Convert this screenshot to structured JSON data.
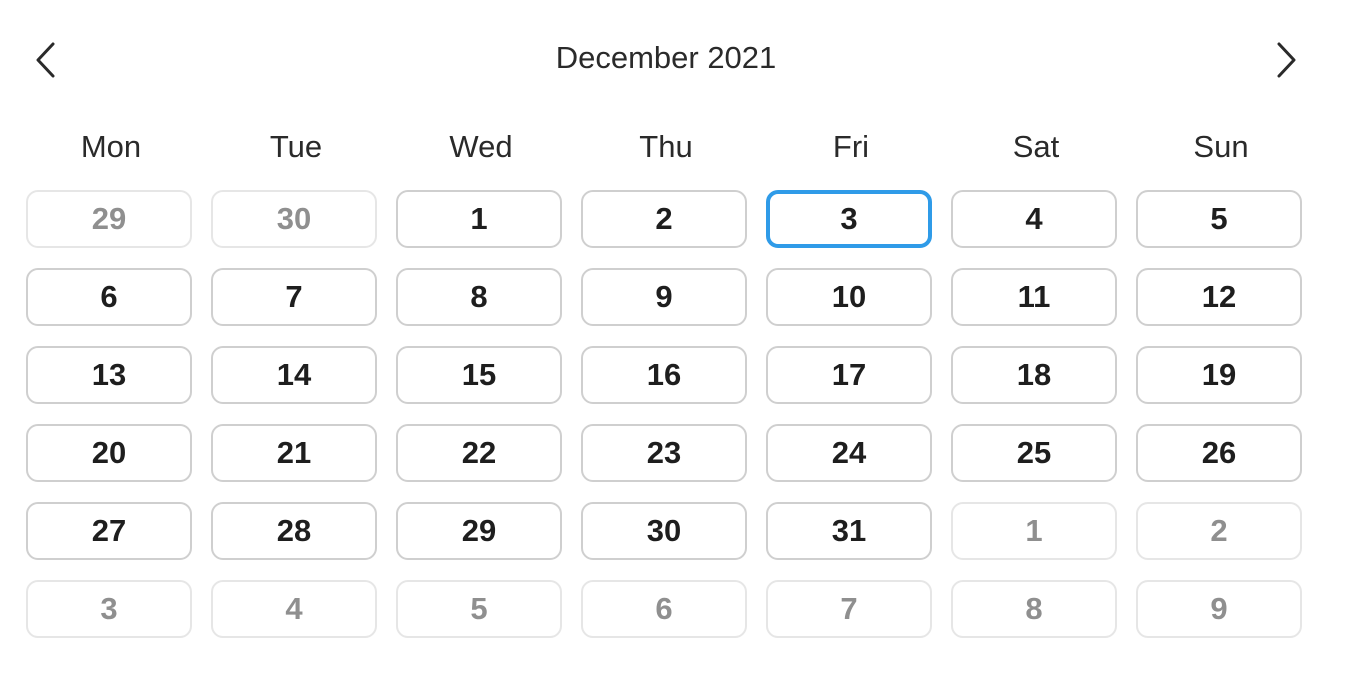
{
  "calendar": {
    "title": "December 2021",
    "prev_icon": "chevron-left-icon",
    "next_icon": "chevron-right-icon",
    "accent_color": "#2f9be8",
    "weekdays": [
      "Mon",
      "Tue",
      "Wed",
      "Thu",
      "Fri",
      "Sat",
      "Sun"
    ],
    "weeks": [
      [
        {
          "label": "29",
          "outside": true
        },
        {
          "label": "30",
          "outside": true
        },
        {
          "label": "1"
        },
        {
          "label": "2"
        },
        {
          "label": "3",
          "selected": true
        },
        {
          "label": "4"
        },
        {
          "label": "5"
        }
      ],
      [
        {
          "label": "6"
        },
        {
          "label": "7"
        },
        {
          "label": "8"
        },
        {
          "label": "9"
        },
        {
          "label": "10"
        },
        {
          "label": "11"
        },
        {
          "label": "12"
        }
      ],
      [
        {
          "label": "13"
        },
        {
          "label": "14"
        },
        {
          "label": "15"
        },
        {
          "label": "16"
        },
        {
          "label": "17"
        },
        {
          "label": "18"
        },
        {
          "label": "19"
        }
      ],
      [
        {
          "label": "20"
        },
        {
          "label": "21"
        },
        {
          "label": "22"
        },
        {
          "label": "23"
        },
        {
          "label": "24"
        },
        {
          "label": "25"
        },
        {
          "label": "26"
        }
      ],
      [
        {
          "label": "27"
        },
        {
          "label": "28"
        },
        {
          "label": "29"
        },
        {
          "label": "30"
        },
        {
          "label": "31"
        },
        {
          "label": "1",
          "outside": true
        },
        {
          "label": "2",
          "outside": true
        }
      ],
      [
        {
          "label": "3",
          "outside": true
        },
        {
          "label": "4",
          "outside": true
        },
        {
          "label": "5",
          "outside": true
        },
        {
          "label": "6",
          "outside": true
        },
        {
          "label": "7",
          "outside": true
        },
        {
          "label": "8",
          "outside": true
        },
        {
          "label": "9",
          "outside": true
        }
      ]
    ]
  }
}
